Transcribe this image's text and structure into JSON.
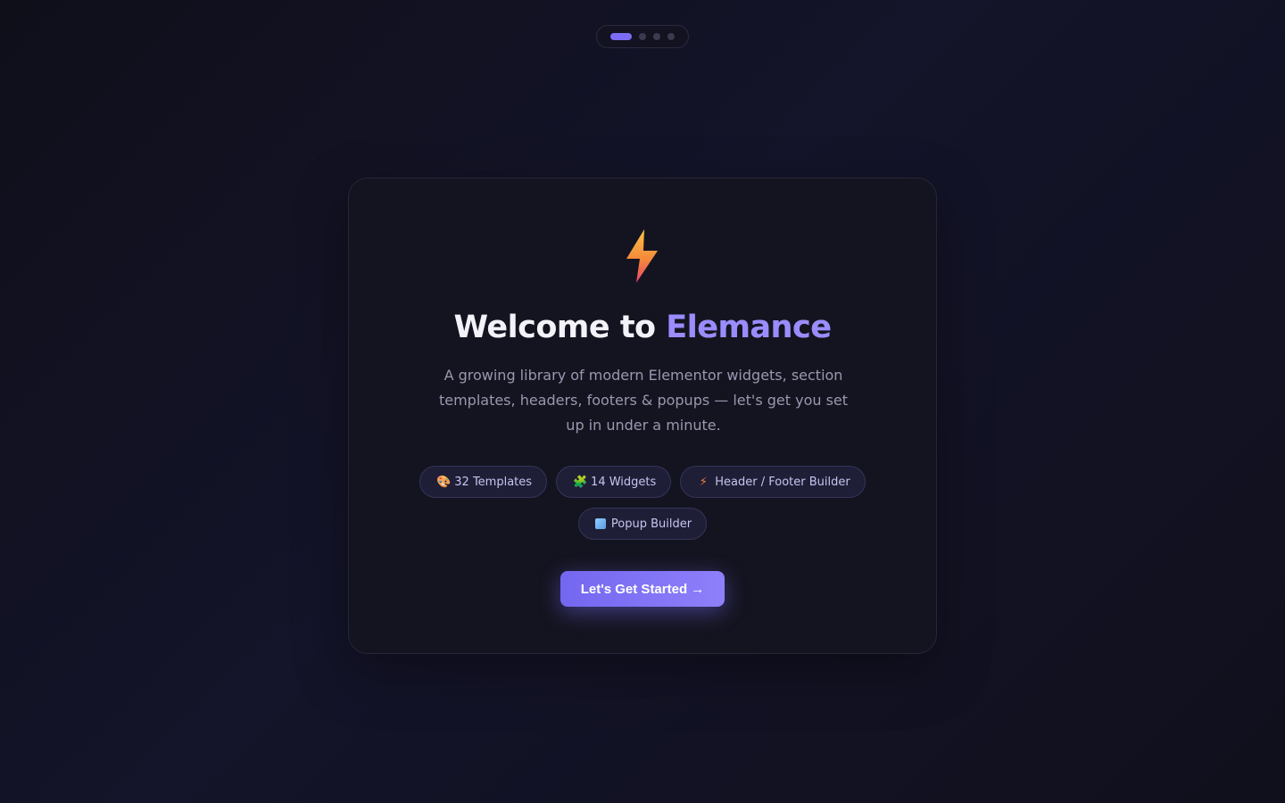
{
  "stepper": {
    "total_steps": 4,
    "current_step": 1
  },
  "icons": {
    "hero": "lightning-bolt-icon",
    "chips": [
      "palette-icon",
      "puzzle-icon",
      "lightning-bolt-icon",
      "popup-window-icon"
    ]
  },
  "welcome": {
    "title_prefix": "Welcome to",
    "brand_name": "Elemance",
    "description": "A growing library of modern Elementor widgets, section templates, headers, footers & popups — let's get you set up in under a minute."
  },
  "features": [
    {
      "icon": "🎨",
      "label": "32 Templates"
    },
    {
      "icon": "🧩",
      "label": "14 Widgets"
    },
    {
      "icon": "⚡",
      "label": "Header / Footer Builder"
    },
    {
      "icon": "",
      "label": "Popup Builder"
    }
  ],
  "cta": {
    "label": "Let's Get Started →"
  },
  "colors": {
    "accent": "#7b6cf6",
    "background": "#12121f",
    "card": "#141420"
  }
}
